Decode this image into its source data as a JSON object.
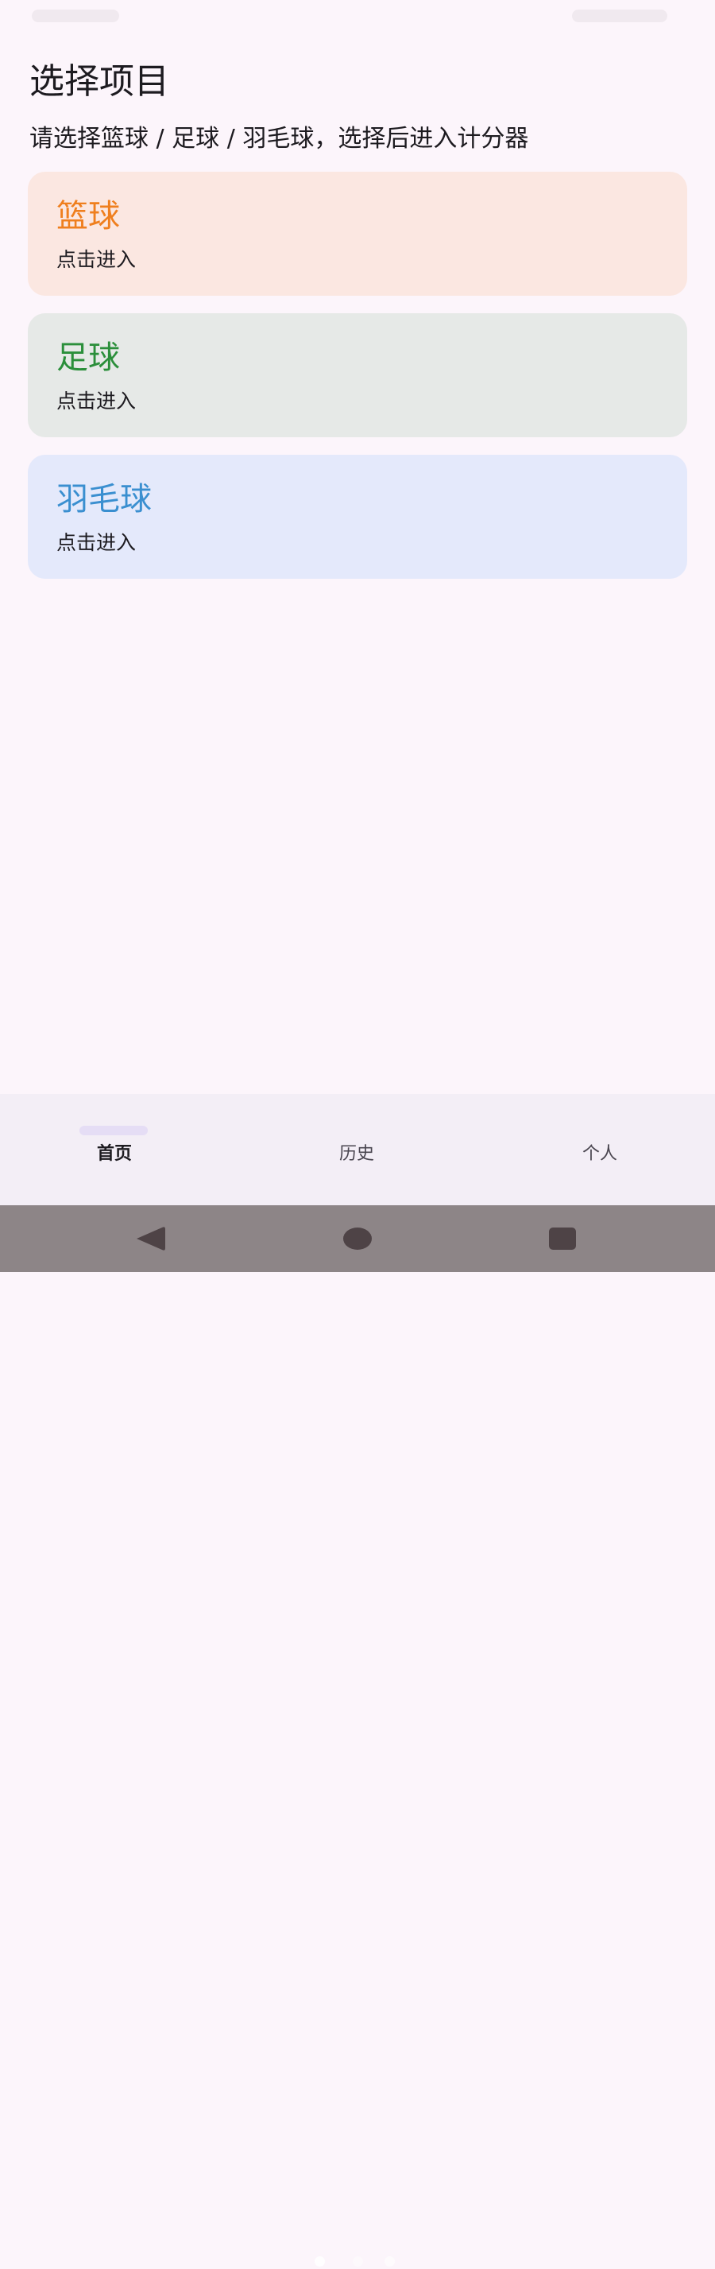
{
  "page": {
    "title": "选择项目",
    "subtitle": "请选择篮球 / 足球 / 羽毛球，选择后进入计分器"
  },
  "sports": [
    {
      "name": "篮球",
      "action": "点击进入",
      "title_color": "#ef7f1e",
      "card_color": "#fbe7e1"
    },
    {
      "name": "足球",
      "action": "点击进入",
      "title_color": "#2b8f3b",
      "card_color": "#e6e9e7"
    },
    {
      "name": "羽毛球",
      "action": "点击进入",
      "title_color": "#3a8fd0",
      "card_color": "#e4e9fb"
    }
  ],
  "bottom_nav": {
    "items": [
      {
        "label": "首页",
        "selected": true
      },
      {
        "label": "历史",
        "selected": false
      },
      {
        "label": "个人",
        "selected": false
      }
    ]
  },
  "system_nav": {
    "icons": [
      "back-icon",
      "home-icon",
      "recents-icon"
    ]
  },
  "colors": {
    "background": "#fcf5fb",
    "nav_background": "#f3eef6",
    "nav_indicator": "#e5ddf5",
    "system_bar": "#8d8587",
    "system_icon": "#4e4346"
  }
}
